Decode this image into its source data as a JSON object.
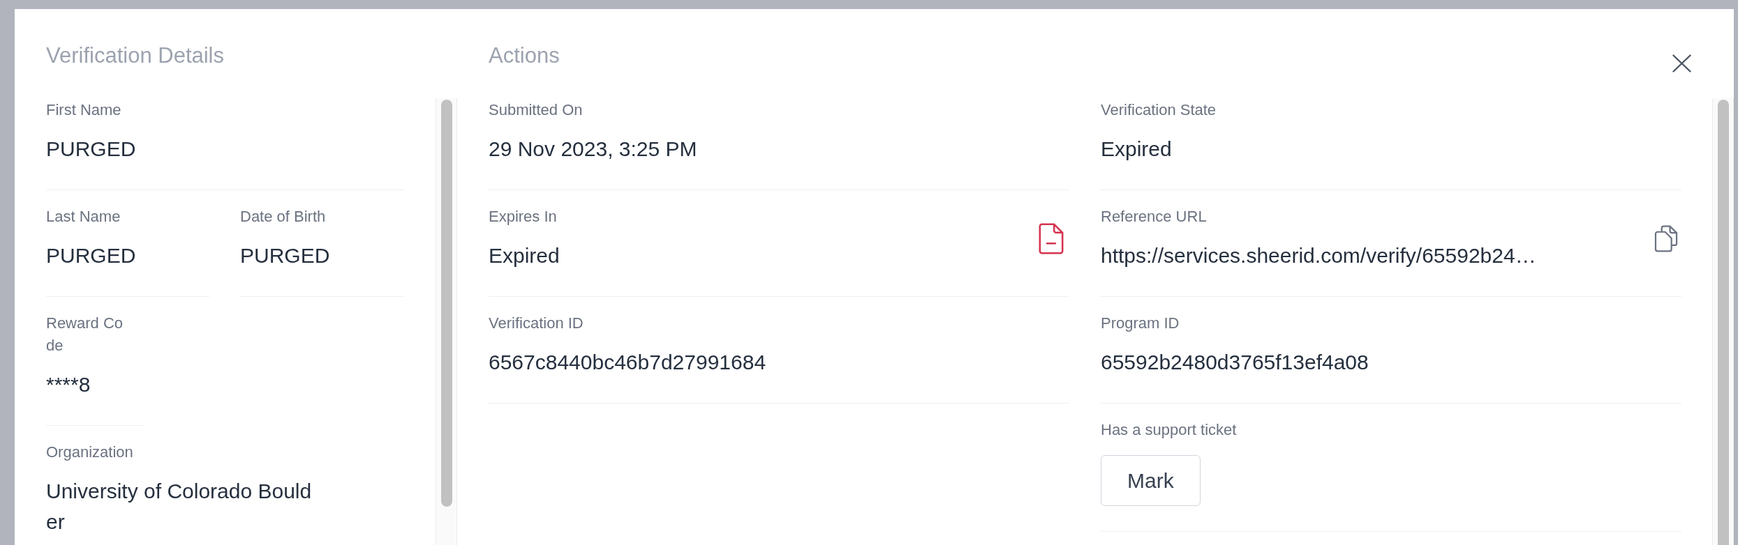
{
  "details": {
    "title": "Verification Details",
    "rows": [
      {
        "fields": [
          {
            "label": "First Name",
            "value": "PURGED"
          }
        ]
      },
      {
        "fields": [
          {
            "label": "Last Name",
            "value": "PURGED"
          },
          {
            "label": "Date of Birth",
            "value": "PURGED"
          }
        ]
      },
      {
        "fields": [
          {
            "label": "Reward Code",
            "value": "****8"
          }
        ]
      },
      {
        "fields": [
          {
            "label": "Organization",
            "value": "University of Colorado Boulder"
          }
        ]
      }
    ]
  },
  "actions": {
    "title": "Actions",
    "columns": [
      {
        "fields": [
          {
            "kind": "plain",
            "label": "Submitted On",
            "value": "29 Nov 2023, 3:25 PM"
          },
          {
            "kind": "document",
            "label": "Expires In",
            "value": "Expired"
          },
          {
            "kind": "plain",
            "label": "Verification ID",
            "value": "6567c8440bc46b7d27991684"
          }
        ]
      },
      {
        "fields": [
          {
            "kind": "plain",
            "label": "Verification State",
            "value": "Expired"
          },
          {
            "kind": "copyable",
            "label": "Reference URL",
            "value": "https://services.sheerid.com/verify/65592b24…"
          },
          {
            "kind": "plain",
            "label": "Program ID",
            "value": "65592b2480d3765f13ef4a08"
          },
          {
            "kind": "button",
            "label": "Has a support ticket",
            "button": "Mark"
          }
        ]
      }
    ]
  }
}
